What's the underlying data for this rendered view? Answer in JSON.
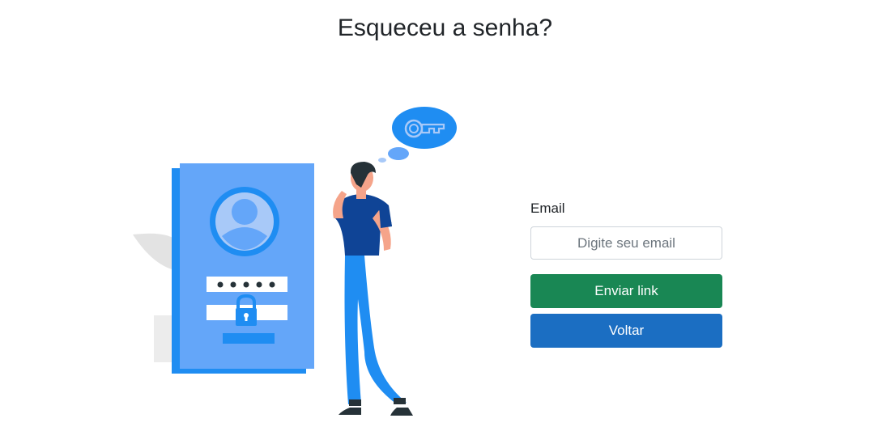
{
  "page": {
    "title": "Esqueceu a senha?"
  },
  "form": {
    "email_label": "Email",
    "email_placeholder": "Digite seu email",
    "email_value": "",
    "send_label": "Enviar link",
    "back_label": "Voltar"
  },
  "colors": {
    "send_button": "#198754",
    "back_button": "#1b6ec2",
    "illustration_blue": "#1f8df2"
  },
  "icons": [
    "user-icon",
    "lock-icon",
    "key-icon"
  ]
}
